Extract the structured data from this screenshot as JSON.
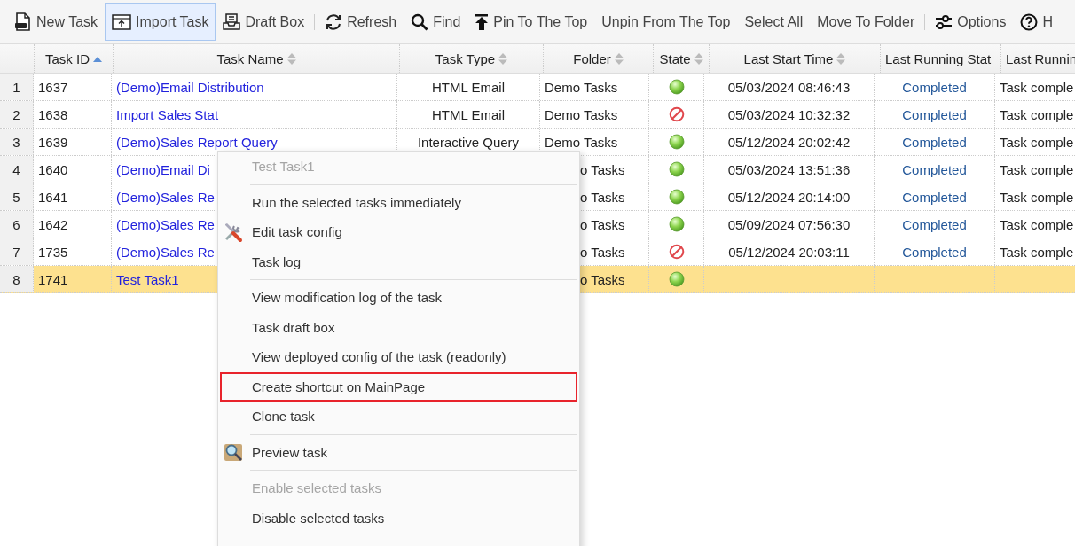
{
  "toolbar": [
    {
      "kind": "new",
      "label": "New Task",
      "selected": false
    },
    {
      "kind": "import",
      "label": "Import Task",
      "selected": true
    },
    {
      "kind": "draft",
      "label": "Draft Box",
      "selected": false
    },
    {
      "kind": "separator"
    },
    {
      "kind": "refresh",
      "label": "Refresh",
      "selected": false
    },
    {
      "kind": "find",
      "label": "Find",
      "selected": false
    },
    {
      "kind": "pin",
      "label": "Pin To The Top",
      "selected": false
    },
    {
      "kind": "plain",
      "label": "Unpin From The Top",
      "selected": false
    },
    {
      "kind": "plain",
      "label": "Select All",
      "selected": false
    },
    {
      "kind": "plain",
      "label": "Move To Folder",
      "selected": false
    },
    {
      "kind": "separator"
    },
    {
      "kind": "options",
      "label": "Options",
      "selected": false
    },
    {
      "kind": "help",
      "label": "H",
      "selected": false
    }
  ],
  "table": {
    "columns": [
      {
        "label": "Task ID",
        "sorted": true
      },
      {
        "label": "Task Name",
        "sorted": false
      },
      {
        "label": "Task Type",
        "sorted": false
      },
      {
        "label": "Folder",
        "sorted": false
      },
      {
        "label": "State",
        "sorted": false
      },
      {
        "label": "Last Start Time",
        "sorted": false
      },
      {
        "label": "Last Running Stat"
      },
      {
        "label": "Last Runnin"
      }
    ],
    "rows": [
      {
        "number": "1",
        "task_id": "1637",
        "task_name": "(Demo)Email Distribution",
        "task_type": "HTML Email",
        "folder": "Demo Tasks",
        "enabled": true,
        "last_start_time": "05/03/2024 08:46:43",
        "last_running_state": "Completed",
        "column_8": "Task comple",
        "selected": false
      },
      {
        "number": "2",
        "task_id": "1638",
        "task_name": "Import Sales Stat",
        "task_type": "HTML Email",
        "folder": "Demo Tasks",
        "enabled": false,
        "last_start_time": "05/03/2024 10:32:32",
        "last_running_state": "Completed",
        "column_8": "Task comple",
        "selected": false
      },
      {
        "number": "3",
        "task_id": "1639",
        "task_name": "(Demo)Sales Report Query",
        "task_type": "Interactive Query",
        "folder": "Demo Tasks",
        "enabled": true,
        "last_start_time": "05/12/2024 20:02:42",
        "last_running_state": "Completed",
        "column_8": "Task comple",
        "selected": false
      },
      {
        "number": "4",
        "task_id": "1640",
        "task_name": "(Demo)Email Di",
        "folder": "o Tasks",
        "enabled": true,
        "last_start_time": "05/03/2024 13:51:36",
        "last_running_state": "Completed",
        "column_8": "Task comple",
        "selected": false
      },
      {
        "number": "5",
        "task_id": "1641",
        "task_name": "(Demo)Sales Re",
        "folder": "o Tasks",
        "enabled": true,
        "last_start_time": "05/12/2024 20:14:00",
        "last_running_state": "Completed",
        "column_8": "Task comple",
        "selected": false
      },
      {
        "number": "6",
        "task_id": "1642",
        "task_name": "(Demo)Sales Re",
        "folder": "o Tasks",
        "enabled": true,
        "last_start_time": "05/09/2024 07:56:30",
        "last_running_state": "Completed",
        "column_8": "Task comple",
        "selected": false
      },
      {
        "number": "7",
        "task_id": "1735",
        "task_name": "(Demo)Sales Re",
        "folder": "o Tasks",
        "enabled": false,
        "last_start_time": "05/12/2024 20:03:11",
        "last_running_state": "Completed",
        "column_8": "Task comple",
        "selected": false
      },
      {
        "number": "8",
        "task_id": "1741",
        "task_name": "Test Task1",
        "folder": "o Tasks",
        "enabled": true,
        "selected": true
      }
    ]
  },
  "context_menu": {
    "title": "Test Task1",
    "groups": [
      [
        {
          "label": "Run the selected tasks immediately",
          "kind": "plain",
          "disabled": false,
          "annotated": false
        },
        {
          "label": "Edit task config",
          "kind": "tools",
          "disabled": false,
          "annotated": false
        },
        {
          "label": "Task log",
          "kind": "plain",
          "disabled": false,
          "annotated": false
        }
      ],
      [
        {
          "label": "View modification log of the task",
          "kind": "plain",
          "disabled": false,
          "annotated": false
        },
        {
          "label": "Task draft box",
          "kind": "plain",
          "disabled": false,
          "annotated": false
        },
        {
          "label": "View deployed config of the task (readonly)",
          "kind": "plain",
          "disabled": false,
          "annotated": false
        },
        {
          "label": "Create shortcut on MainPage",
          "kind": "plain",
          "disabled": false,
          "annotated": true
        },
        {
          "label": "Clone task",
          "kind": "plain",
          "disabled": false,
          "annotated": false
        }
      ],
      [
        {
          "label": "Preview task",
          "kind": "magnifier",
          "disabled": false,
          "annotated": false
        }
      ],
      [
        {
          "label": "Enable selected tasks",
          "kind": "plain",
          "disabled": true,
          "annotated": false
        },
        {
          "label": "Disable selected tasks",
          "kind": "plain",
          "disabled": false,
          "annotated": false
        }
      ]
    ]
  }
}
